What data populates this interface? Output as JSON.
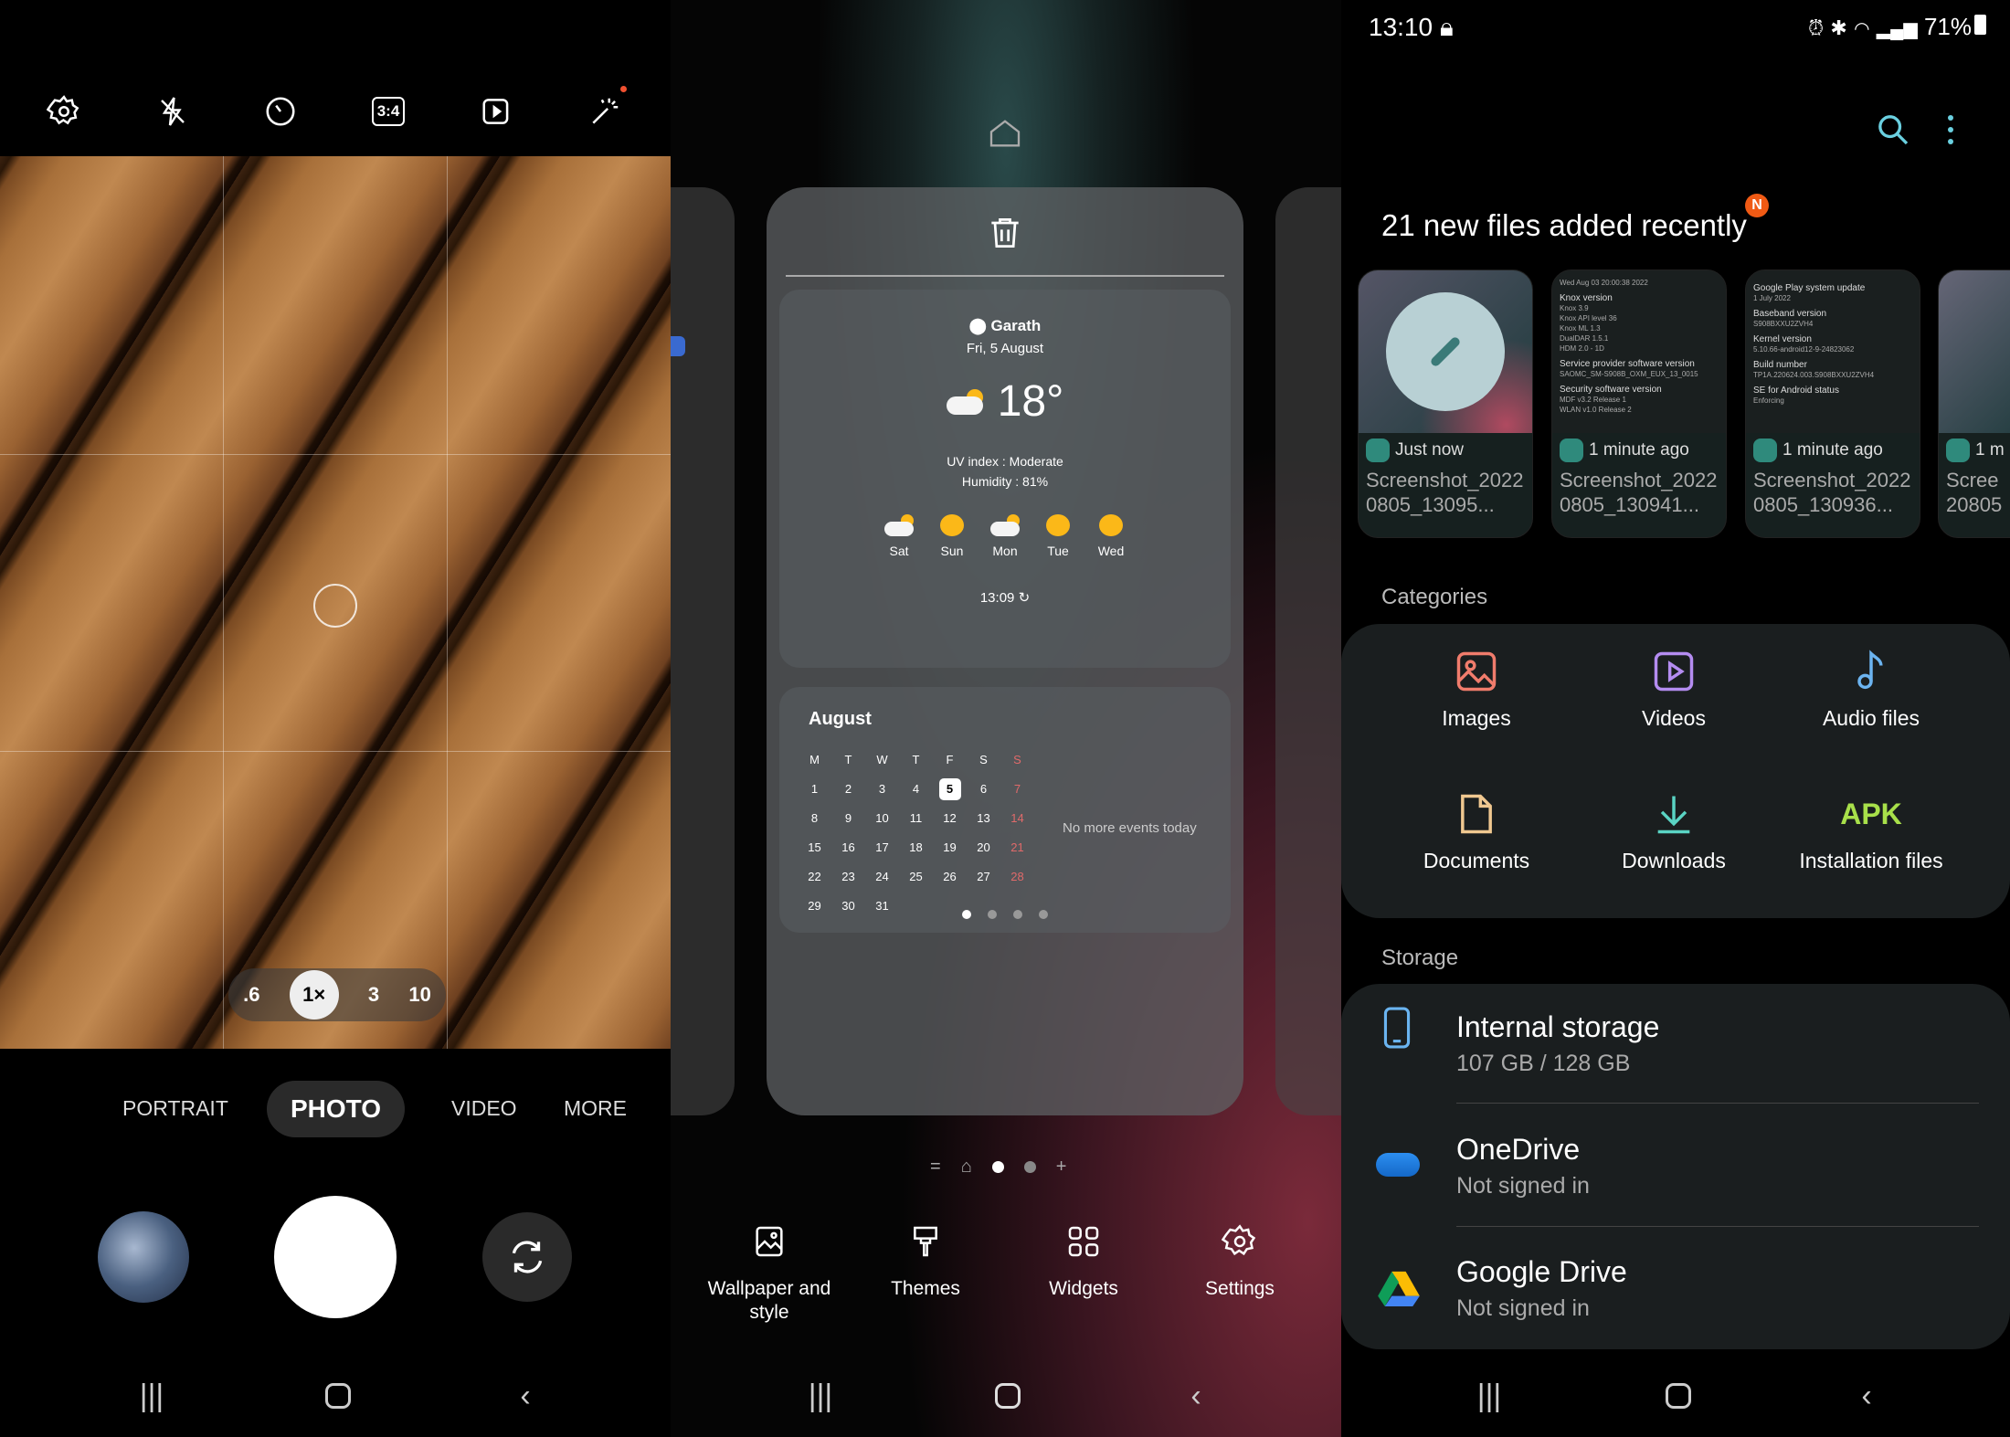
{
  "camera": {
    "toolbar": [
      "settings-icon",
      "flash-off-icon",
      "timer-icon",
      "ratio-3-4-icon",
      "motion-photo-icon",
      "filters-icon"
    ],
    "ratio_label": "3:4",
    "zoom_levels": [
      ".6",
      "1×",
      "3",
      "10"
    ],
    "zoom_selected": "1×",
    "modes": [
      "PORTRAIT",
      "PHOTO",
      "VIDEO",
      "MORE"
    ],
    "mode_selected": "PHOTO"
  },
  "home_edit": {
    "weather": {
      "location": "Garath",
      "date": "Fri, 5 August",
      "temp": "18°",
      "uv": "UV index : Moderate",
      "humidity": "Humidity : 81%",
      "forecast": [
        {
          "day": "Sat",
          "icon": "partly-cloudy"
        },
        {
          "day": "Sun",
          "icon": "sunny"
        },
        {
          "day": "Mon",
          "icon": "partly-cloudy"
        },
        {
          "day": "Tue",
          "icon": "sunny"
        },
        {
          "day": "Wed",
          "icon": "sunny"
        }
      ],
      "updated": "13:09"
    },
    "calendar": {
      "month": "August",
      "weekdays": [
        "M",
        "T",
        "W",
        "T",
        "F",
        "S",
        "S"
      ],
      "weeks": [
        [
          "1",
          "2",
          "3",
          "4",
          "5",
          "6",
          "7"
        ],
        [
          "8",
          "9",
          "10",
          "11",
          "12",
          "13",
          "14"
        ],
        [
          "15",
          "16",
          "17",
          "18",
          "19",
          "20",
          "21"
        ],
        [
          "22",
          "23",
          "24",
          "25",
          "26",
          "27",
          "28"
        ],
        [
          "29",
          "30",
          "31",
          "",
          "",
          "",
          ""
        ]
      ],
      "today": "5",
      "events": "No more events today",
      "sunday_color": "#e06a6a"
    },
    "bottom": [
      {
        "label": "Wallpaper and style",
        "icon": "wallpaper-icon"
      },
      {
        "label": "Themes",
        "icon": "brush-icon"
      },
      {
        "label": "Widgets",
        "icon": "widgets-icon"
      },
      {
        "label": "Settings",
        "icon": "settings-icon"
      }
    ]
  },
  "files": {
    "status": {
      "time": "13:10",
      "battery": "71%"
    },
    "title": "21 new files added recently",
    "badge": "N",
    "recent": [
      {
        "time": "Just now",
        "name": "Screenshot_20220805_13095..."
      },
      {
        "time": "1 minute ago",
        "name": "Screenshot_20220805_130941..."
      },
      {
        "time": "1 minute ago",
        "name": "Screenshot_20220805_130936..."
      },
      {
        "time": "1 m",
        "name": "Scree 20805"
      }
    ],
    "thumb2": [
      "Wed Aug 03 20:00:38 2022",
      "Knox version",
      "Knox 3.9",
      "Knox API level 36",
      "Knox ML 1.3",
      "DualDAR 1.5.1",
      "HDM 2.0 - 1D",
      "Service provider software version",
      "SAOMC_SM-S908B_OXM_EUX_13_0015",
      "Security software version",
      "MDF v3.2 Release 1",
      "WLAN v1.0 Release 2"
    ],
    "thumb3": [
      "Google Play system update",
      "1 July 2022",
      "Baseband version",
      "S908BXXU2ZVH4",
      "Kernel version",
      "5.10.66-android12-9-24823062",
      "Build number",
      "TP1A.220624.003.S908BXXU2ZVH4",
      "SE for Android status",
      "Enforcing"
    ],
    "categories_label": "Categories",
    "categories": [
      {
        "label": "Images",
        "icon": "image-icon",
        "color": "#f07c6c"
      },
      {
        "label": "Videos",
        "icon": "video-icon",
        "color": "#b48cf0"
      },
      {
        "label": "Audio files",
        "icon": "music-icon",
        "color": "#6cb4f0"
      },
      {
        "label": "Documents",
        "icon": "document-icon",
        "color": "#f0c890"
      },
      {
        "label": "Downloads",
        "icon": "download-icon",
        "color": "#5ad4c4"
      },
      {
        "label": "Installation files",
        "icon": "apk-icon",
        "color": "#a8e04a",
        "glyph": "APK"
      }
    ],
    "storage_label": "Storage",
    "storage": [
      {
        "title": "Internal storage",
        "sub": "107 GB / 128 GB"
      },
      {
        "title": "OneDrive",
        "sub": "Not signed in"
      },
      {
        "title": "Google Drive",
        "sub": "Not signed in"
      }
    ],
    "accent": "#6ad0e0"
  }
}
